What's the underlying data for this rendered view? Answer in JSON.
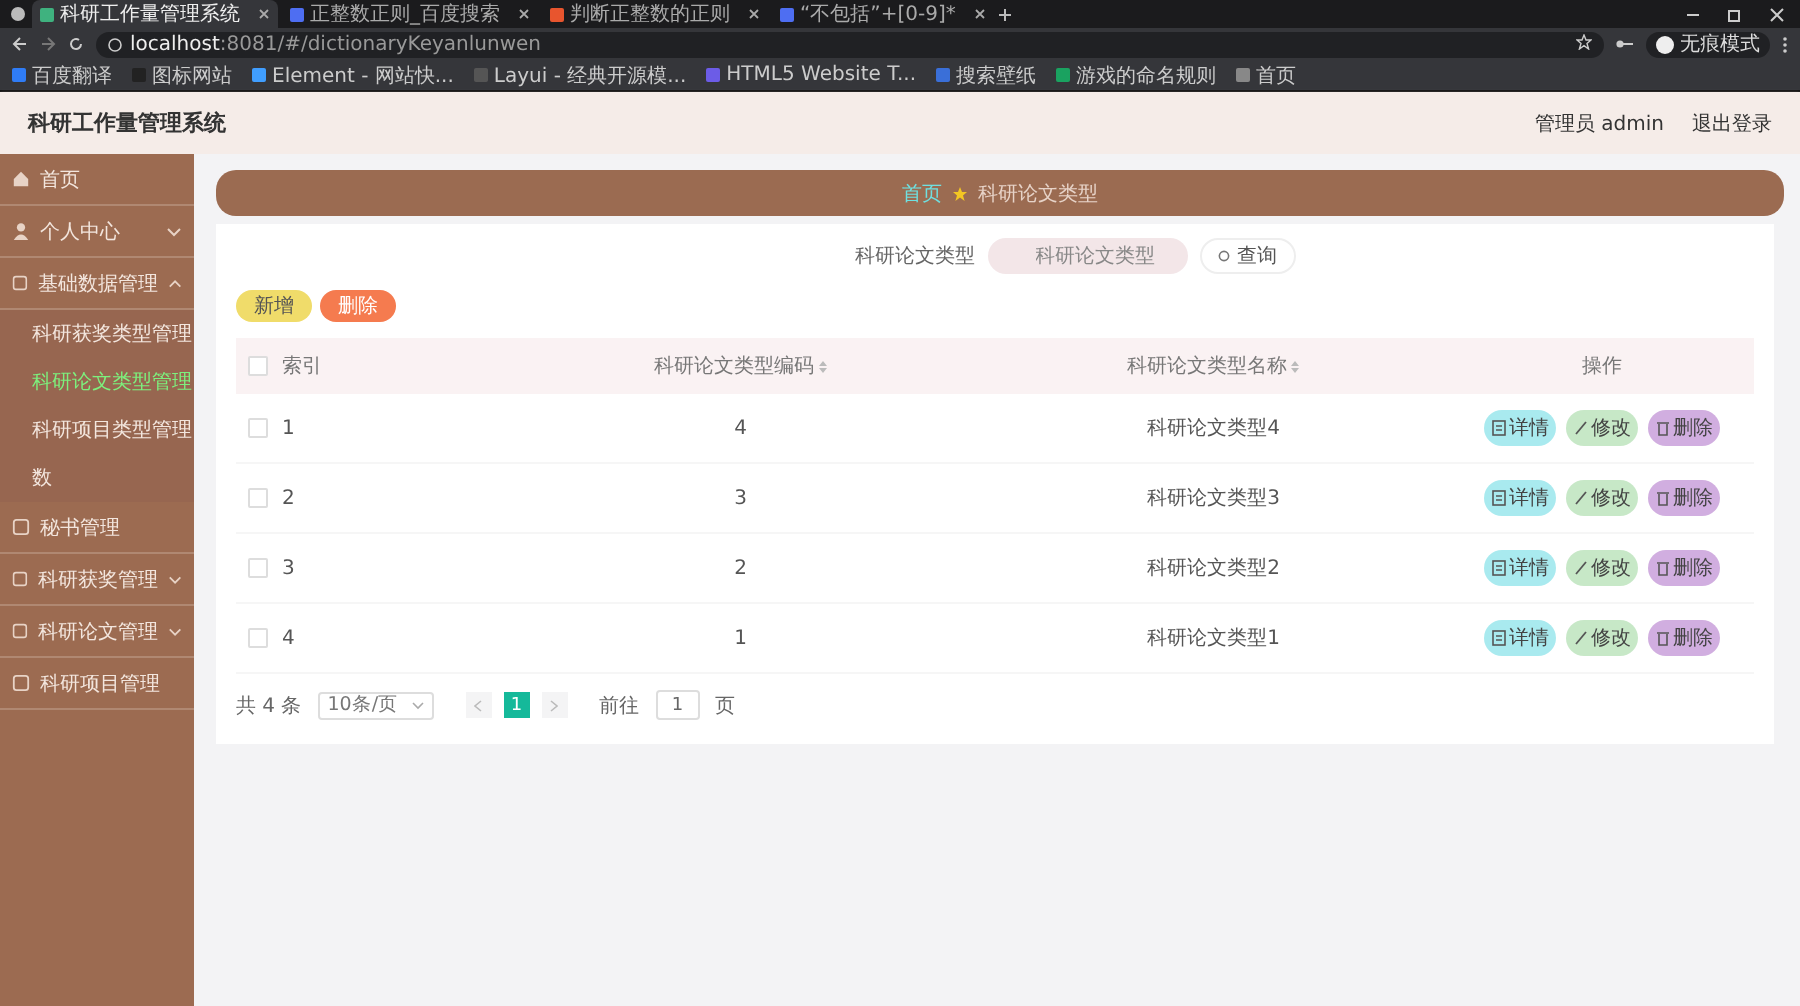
{
  "browser": {
    "tabs": [
      {
        "title": "科研工作量管理系统",
        "selected": true,
        "color": "#3fb27f"
      },
      {
        "title": "正整数正则_百度搜索",
        "selected": false,
        "color": "#4e6ef2"
      },
      {
        "title": "判断正整数的正则",
        "selected": false,
        "color": "#e8552e"
      },
      {
        "title": "“不包括”+[0-9]*",
        "selected": false,
        "color": "#4e6ef2"
      }
    ],
    "url_host": "localhost",
    "url_path": ":8081/#/dictionaryKeyanlunwen",
    "bookmarks": [
      {
        "label": "百度翻译",
        "color": "#2f7cf6"
      },
      {
        "label": "图标网站",
        "color": "#222222"
      },
      {
        "label": "Element - 网站快...",
        "color": "#409eff"
      },
      {
        "label": "Layui - 经典开源模...",
        "color": "#555555"
      },
      {
        "label": "HTML5 Website T...",
        "color": "#6c5ce7"
      },
      {
        "label": "搜索壁纸",
        "color": "#3a6fd8"
      },
      {
        "label": "游戏的命名规则",
        "color": "#1aa260"
      },
      {
        "label": "首页",
        "color": "#888888"
      }
    ],
    "profile": "无痕模式"
  },
  "header": {
    "title": "科研工作量管理系统",
    "user": "管理员 admin",
    "logout": "退出登录"
  },
  "sidebar": {
    "items": [
      {
        "label": "首页",
        "kind": "home"
      },
      {
        "label": "个人中心",
        "kind": "person",
        "expanded": false
      },
      {
        "label": "基础数据管理",
        "kind": "folder",
        "expanded": true,
        "children": [
          {
            "label": "科研获奖类型管理",
            "selected": false
          },
          {
            "label": "科研论文类型管理",
            "selected": true
          },
          {
            "label": "科研项目类型管理",
            "selected": false
          },
          {
            "label": "数",
            "selected": false
          }
        ]
      },
      {
        "label": "秘书管理",
        "kind": "folder"
      },
      {
        "label": "科研获奖管理",
        "kind": "folder",
        "expanded": false
      },
      {
        "label": "科研论文管理",
        "kind": "folder",
        "expanded": false
      },
      {
        "label": "科研项目管理",
        "kind": "folder"
      }
    ]
  },
  "breadcrumb": {
    "home": "首页",
    "current": "科研论文类型"
  },
  "search": {
    "label": "科研论文类型",
    "placeholder": "科研论文类型",
    "button": "查询"
  },
  "actions": [
    {
      "label": "新增",
      "kind": "add"
    },
    {
      "label": "删除",
      "kind": "delete"
    }
  ],
  "table": {
    "all_checked": false,
    "columns": [
      {
        "label": "索引",
        "sortable": false
      },
      {
        "label": "科研论文类型编码",
        "sortable": true
      },
      {
        "label": "科研论文类型名称",
        "sortable": true
      },
      {
        "label": "操作",
        "sortable": false
      }
    ],
    "rows": [
      {
        "checked": false,
        "index": "1",
        "code": "4",
        "name": "科研论文类型4",
        "actions": [
          {
            "label": "详情",
            "kind": "detail"
          },
          {
            "label": "修改",
            "kind": "edit"
          },
          {
            "label": "删除",
            "kind": "delete"
          }
        ]
      },
      {
        "checked": false,
        "index": "2",
        "code": "3",
        "name": "科研论文类型3",
        "actions": [
          {
            "label": "详情",
            "kind": "detail"
          },
          {
            "label": "修改",
            "kind": "edit"
          },
          {
            "label": "删除",
            "kind": "delete"
          }
        ]
      },
      {
        "checked": false,
        "index": "3",
        "code": "2",
        "name": "科研论文类型2",
        "actions": [
          {
            "label": "详情",
            "kind": "detail"
          },
          {
            "label": "修改",
            "kind": "edit"
          },
          {
            "label": "删除",
            "kind": "delete"
          }
        ]
      },
      {
        "checked": false,
        "index": "4",
        "code": "1",
        "name": "科研论文类型1",
        "actions": [
          {
            "label": "详情",
            "kind": "detail"
          },
          {
            "label": "修改",
            "kind": "edit"
          },
          {
            "label": "删除",
            "kind": "delete"
          }
        ]
      }
    ]
  },
  "pagination": {
    "total": "共 4 条",
    "page_size": "10条/页",
    "pages": [
      {
        "label": "1",
        "selected": true
      }
    ],
    "goto_label": "前往",
    "goto_value": "1",
    "goto_suffix": "页"
  }
}
